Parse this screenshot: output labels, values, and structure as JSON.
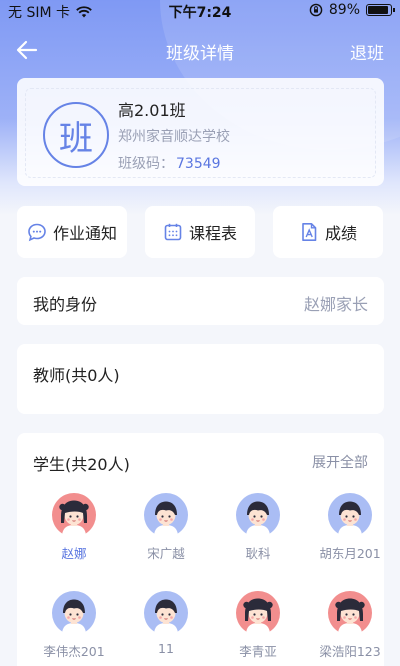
{
  "status_bar": {
    "carrier": "无 SIM 卡",
    "time": "下午7:24",
    "battery": "89%",
    "battery_level": 0.89
  },
  "nav": {
    "title": "班级详情",
    "right_action": "退班",
    "back_icon": "arrow-left-icon"
  },
  "class_info": {
    "badge": "班",
    "name": "高2.01班",
    "school": "郑州家音顺达学校",
    "code_label": "班级码：",
    "code": "73549"
  },
  "functions": [
    {
      "label": "作业通知",
      "icon": "chat-bubble-icon"
    },
    {
      "label": "课程表",
      "icon": "calendar-icon"
    },
    {
      "label": "成绩",
      "icon": "document-icon"
    }
  ],
  "identity": {
    "label": "我的身份",
    "value": "赵娜家长"
  },
  "teachers": {
    "title": "教师(共0人)"
  },
  "students": {
    "title": "学生(共20人)",
    "expand": "展开全部",
    "list": [
      {
        "name": "赵娜",
        "gender": "girl"
      },
      {
        "name": "宋广越",
        "gender": "boy"
      },
      {
        "name": "耿科",
        "gender": "boy"
      },
      {
        "name": "胡东月201",
        "gender": "boy"
      },
      {
        "name": "李伟杰201",
        "gender": "boy"
      },
      {
        "name": "11",
        "gender": "boy"
      },
      {
        "name": "李青亚",
        "gender": "girl"
      },
      {
        "name": "梁浩阳123",
        "gender": "girl"
      }
    ]
  },
  "colors": {
    "accent": "#5a76e0",
    "header_gradient_top": "#7f99f4",
    "girl_avatar_bg": "#f28e8e",
    "boy_avatar_bg": "#aabdf4"
  }
}
